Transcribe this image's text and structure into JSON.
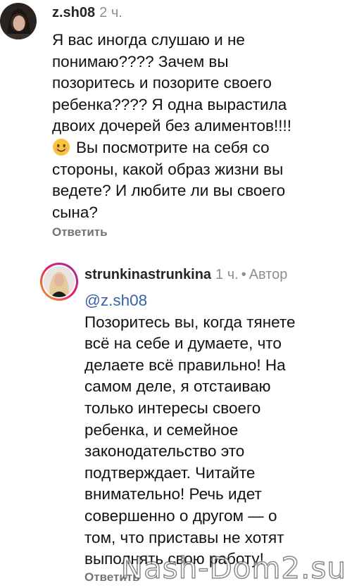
{
  "comment": {
    "username": "z.sh08",
    "time": "2 ч.",
    "lines": [
      "Я вас иногда слушаю и не",
      "понимаю???? Зачем вы",
      "позоритесь и позорите своего",
      "ребенка???? Я одна вырастила",
      "двоих дочерей без алиментов!!!!",
      "Вы посмотрите на себя со",
      "стороны, какой образ жизни вы",
      "ведете? И любите ли вы своего",
      "сына?"
    ],
    "emoji_icon": "smiling-face-emoji",
    "reply_label": "Ответить"
  },
  "reply": {
    "username": "strunkinastrunkina",
    "time": "1 ч.",
    "separator": "•",
    "author_label": "Автор",
    "mention": "@z.sh08",
    "lines": [
      "Позоритесь вы, когда тянете",
      "всё на себе и думаете, что",
      "делаете всё правильно! На",
      "самом деле, я отстаиваю",
      "только интересы своего",
      "ребенка, и семейное",
      "законодательство это",
      "подтверждает. Читайте",
      "внимательно! Речь идет",
      "совершенно о другом — о",
      "том, что приставы не хотят",
      "выполнять свою работу!"
    ],
    "reply_label": "Ответить"
  },
  "watermark": "Nash-Dom2.su",
  "colors": {
    "mention": "#3b62a8",
    "secondary_text": "#8e8e8e",
    "reply_button": "#737373"
  }
}
